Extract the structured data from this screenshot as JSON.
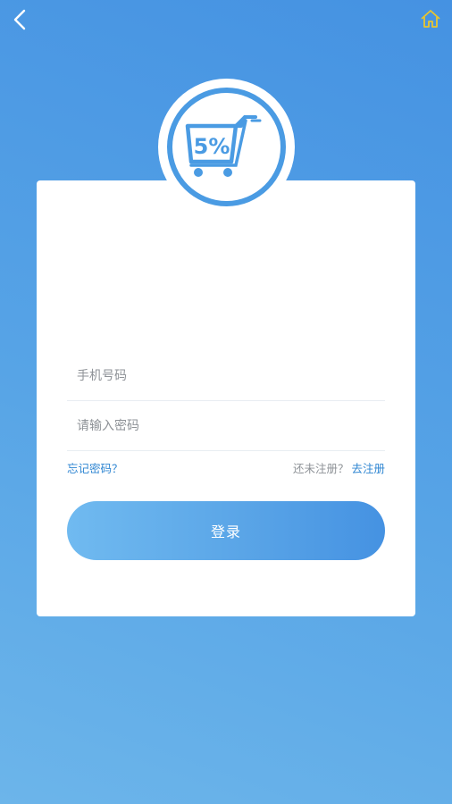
{
  "header": {
    "back_icon": "chevron-left-icon",
    "home_icon": "home-icon",
    "home_icon_color": "#e8c52e"
  },
  "logo": {
    "text": "5%",
    "icon": "shopping-cart-icon",
    "accent": "#4a9be3"
  },
  "form": {
    "phone_placeholder": "手机号码",
    "password_placeholder": "请输入密码",
    "forgot_label": "忘记密码？",
    "register_hint": "还未注册？",
    "register_link": "去注册",
    "login_label": "登录"
  },
  "colors": {
    "background_top": "#4592e2",
    "background_bottom": "#6cb5ea",
    "link": "#2f86d2",
    "card": "#ffffff"
  }
}
